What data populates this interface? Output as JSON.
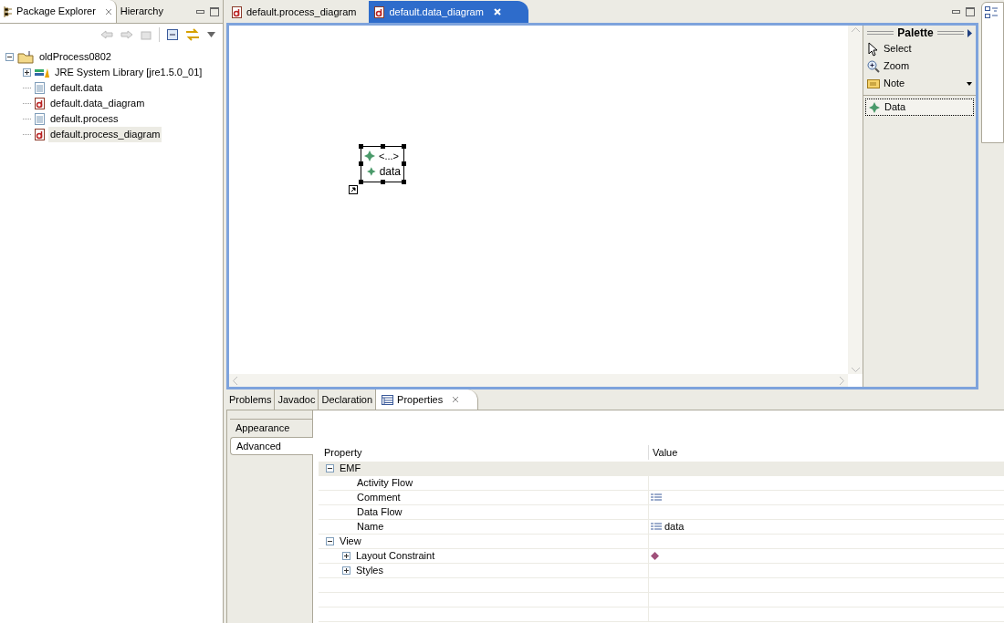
{
  "left_tabs": [
    {
      "label": "Package Explorer",
      "selected": true
    },
    {
      "label": "Hierarchy",
      "selected": false
    }
  ],
  "tree": [
    {
      "label": "oldProcess0802",
      "kind": "project",
      "expanded": true,
      "selected": false,
      "children": [
        {
          "label": "JRE System Library [jre1.5.0_01]",
          "kind": "library",
          "expanded": false,
          "selected": false
        },
        {
          "label": "default.data",
          "kind": "file",
          "selected": false
        },
        {
          "label": "default.data_diagram",
          "kind": "diagram",
          "selected": false
        },
        {
          "label": "default.process",
          "kind": "file",
          "selected": false
        },
        {
          "label": "default.process_diagram",
          "kind": "diagram",
          "selected": true
        }
      ]
    }
  ],
  "editor_tabs": [
    {
      "label": "default.process_diagram",
      "selected": false
    },
    {
      "label": "default.data_diagram",
      "selected": true
    }
  ],
  "diagram": {
    "node": {
      "title": "<...>",
      "label": "data",
      "selected": true
    }
  },
  "palette": {
    "title": "Palette",
    "items": [
      {
        "label": "Select",
        "kind": "select",
        "selected": false
      },
      {
        "label": "Zoom",
        "kind": "zoom",
        "selected": false
      },
      {
        "label": "Note",
        "kind": "note",
        "selected": false
      },
      {
        "label": "Data",
        "kind": "data",
        "selected": true
      }
    ]
  },
  "bottom_tabs": [
    {
      "label": "Problems",
      "selected": false
    },
    {
      "label": "Javadoc",
      "selected": false
    },
    {
      "label": "Declaration",
      "selected": false
    },
    {
      "label": "Properties",
      "selected": true
    }
  ],
  "properties": {
    "sections": [
      {
        "label": "Appearance",
        "selected": false
      },
      {
        "label": "Advanced",
        "selected": true
      }
    ],
    "columns": [
      "Property",
      "Value"
    ],
    "rows": [
      {
        "label": "EMF",
        "expanded": true,
        "children": [
          {
            "label": "Activity Flow"
          },
          {
            "label": "Comment",
            "value": {
              "kind": "list"
            }
          },
          {
            "label": "Data Flow"
          },
          {
            "label": "Name",
            "value": {
              "kind": "list",
              "text": "data"
            }
          }
        ]
      },
      {
        "label": "View",
        "expanded": true,
        "children": [
          {
            "label": "Layout Constraint",
            "expanded": false,
            "value": {
              "kind": "diamond"
            }
          },
          {
            "label": "Styles",
            "expanded": false
          }
        ]
      }
    ]
  }
}
